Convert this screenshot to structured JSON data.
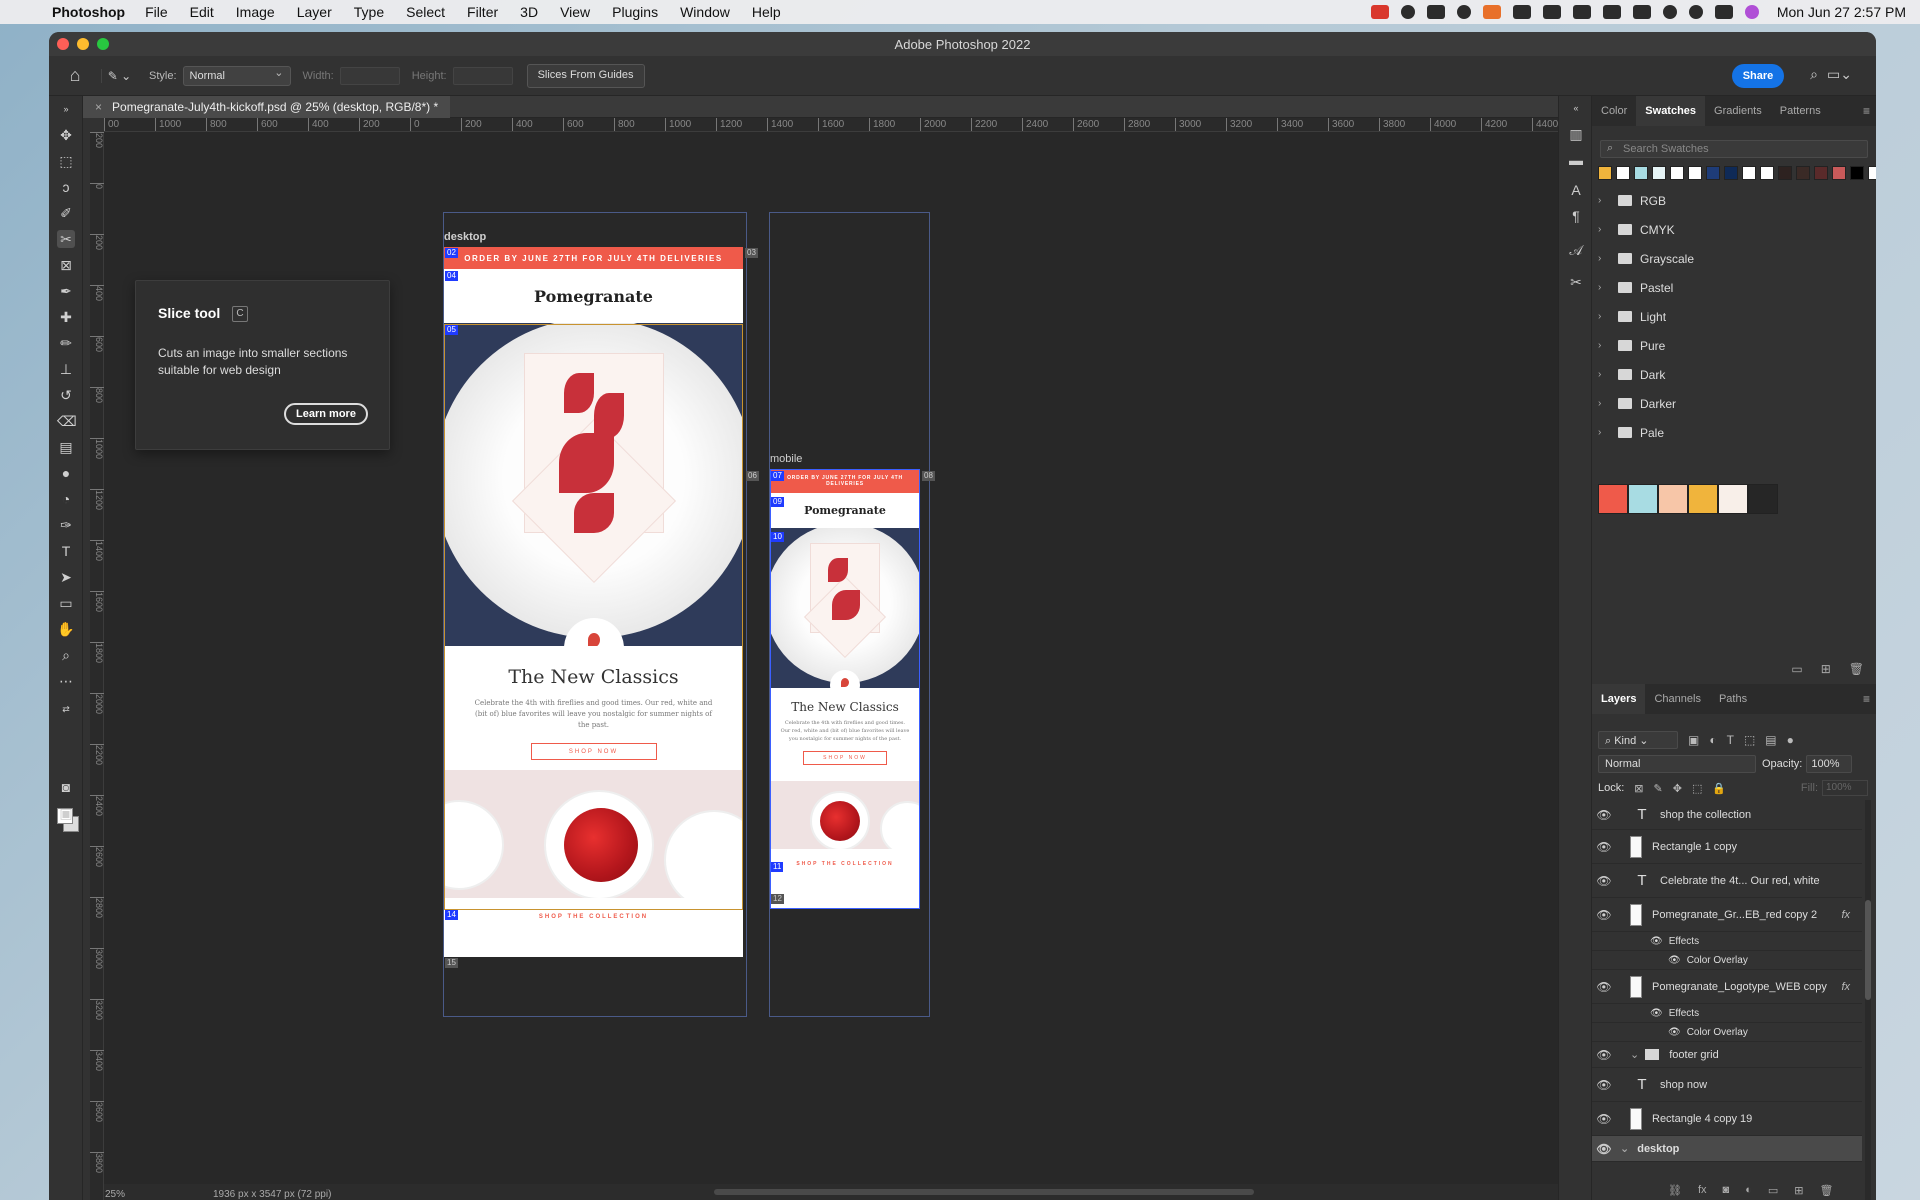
{
  "menubar": {
    "app": "Photoshop",
    "items": [
      "File",
      "Edit",
      "Image",
      "Layer",
      "Type",
      "Select",
      "Filter",
      "3D",
      "View",
      "Plugins",
      "Window",
      "Help"
    ],
    "clock": "Mon Jun 27  2:57 PM"
  },
  "window": {
    "title": "Adobe Photoshop 2022"
  },
  "options": {
    "style_label": "Style:",
    "style_value": "Normal",
    "width_label": "Width:",
    "height_label": "Height:",
    "slices_button": "Slices From Guides",
    "share": "Share"
  },
  "document": {
    "tab_title": "Pomegranate-July4th-kickoff.psd @ 25% (desktop, RGB/8*) *",
    "zoom": "25%",
    "dimensions": "1936 px x 3547 px (72 ppi)"
  },
  "ruler": {
    "h_ticks": [
      "00",
      "1000",
      "800",
      "600",
      "400",
      "200",
      "0",
      "200",
      "400",
      "600",
      "800",
      "1000",
      "1200",
      "1400",
      "1600",
      "1800",
      "2000",
      "2200",
      "2400",
      "2600",
      "2800",
      "3000",
      "3200",
      "3400",
      "3600",
      "3800",
      "4000",
      "4200",
      "4400"
    ],
    "v_ticks": [
      "200",
      "0",
      "200",
      "400",
      "600",
      "800",
      "1000",
      "1200",
      "1400",
      "1600",
      "1800",
      "2000",
      "2200",
      "2400",
      "2600",
      "2800",
      "3000",
      "3200",
      "3400",
      "3600",
      "3800",
      "4000"
    ]
  },
  "tooltip": {
    "title": "Slice tool",
    "shortcut": "C",
    "body": "Cuts an image into smaller sections suitable for web design",
    "learn_more": "Learn more"
  },
  "artboards": {
    "desktop": {
      "label": "desktop",
      "banner": "ORDER BY JUNE 27TH FOR JULY 4TH DELIVERIES",
      "logo": "Pomegranate",
      "headline": "The New Classics",
      "body": "Celebrate the 4th with fireflies and good times. Our red, white and (bit of) blue favorites will leave you nostalgic for summer nights of the past.",
      "shop_now": "SHOP NOW",
      "shop_collection": "SHOP THE COLLECTION",
      "slice_tags": [
        "02",
        "03",
        "04",
        "05",
        "14",
        "15"
      ]
    },
    "mobile": {
      "label": "mobile",
      "banner": "ORDER BY JUNE 27TH FOR JULY 4TH DELIVERIES",
      "logo": "Pomegranate",
      "headline": "The New Classics",
      "body": "Celebrate the 4th with fireflies and good times. Our red, white and (bit of) blue favorites will leave you nostalgic for summer nights of the past.",
      "shop_now": "SHOP NOW",
      "shop_collection": "SHOP THE COLLECTION",
      "slice_tags": [
        "06",
        "07",
        "08",
        "09",
        "10",
        "11",
        "12"
      ]
    }
  },
  "swatches_panel": {
    "tabs": [
      "Color",
      "Swatches",
      "Gradients",
      "Patterns"
    ],
    "active_tab": "Swatches",
    "search_placeholder": "Search Swatches",
    "recent_colors": [
      "#f0b43c",
      "#ffffff",
      "#a8dce3",
      "#e6f4f6",
      "#ffffff",
      "#ffffff",
      "#1e3c78",
      "#0f2a57",
      "#ffffff",
      "#ffffff",
      "#2d2220",
      "#3a2a26",
      "#5a2a2a",
      "#c85a5a",
      "#000000",
      "#ffffff"
    ],
    "folders": [
      "RGB",
      "CMYK",
      "Grayscale",
      "Pastel",
      "Light",
      "Pure",
      "Dark",
      "Darker",
      "Pale"
    ],
    "custom_swatches": [
      "#ef5a4a",
      "#a8dce3",
      "#f7c6a8",
      "#f0b43c",
      "#f8efe9",
      "#262626"
    ]
  },
  "layers_panel": {
    "tabs": [
      "Layers",
      "Channels",
      "Paths"
    ],
    "active_tab": "Layers",
    "kind": "Kind",
    "blend_mode": "Normal",
    "opacity_label": "Opacity:",
    "opacity": "100%",
    "lock_label": "Lock:",
    "fill_label": "Fill:",
    "fill": "100%",
    "layers": [
      {
        "name": "shop the collection",
        "type": "text"
      },
      {
        "name": "Rectangle 1 copy",
        "type": "shape"
      },
      {
        "name": "Celebrate the 4t... Our red, white",
        "type": "text"
      },
      {
        "name": "Pomegranate_Gr...EB_red copy 2",
        "type": "image",
        "fx": true
      },
      {
        "name": "Effects",
        "type": "effects"
      },
      {
        "name": "Color Overlay",
        "type": "effect"
      },
      {
        "name": "Pomegranate_Logotype_WEB copy",
        "type": "image",
        "fx": true
      },
      {
        "name": "Effects",
        "type": "effects"
      },
      {
        "name": "Color Overlay",
        "type": "effect"
      },
      {
        "name": "footer grid",
        "type": "group"
      },
      {
        "name": "shop now",
        "type": "text"
      },
      {
        "name": "Rectangle 4 copy 19",
        "type": "shape"
      },
      {
        "name": "desktop",
        "type": "artboard",
        "selected": true
      }
    ]
  }
}
